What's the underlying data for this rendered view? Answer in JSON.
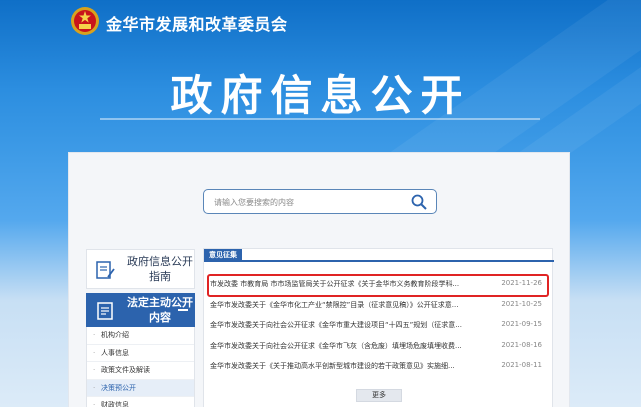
{
  "header": {
    "agency_name": "金华市发展和改革委员会",
    "banner_title": "政府信息公开"
  },
  "search": {
    "placeholder": "请输入您要搜索的内容"
  },
  "sidebar": {
    "guide_label": "政府信息公开指南",
    "section_label": "法定主动公开内容",
    "items": [
      {
        "label": "机构介绍"
      },
      {
        "label": "人事信息"
      },
      {
        "label": "政策文件及解读"
      },
      {
        "label": "决策预公开",
        "active": true
      },
      {
        "label": "财政信息"
      }
    ]
  },
  "content": {
    "tab_label": "意见征集",
    "rows": [
      {
        "title": "市发改委 市教育局 市市场监管局关于公开征求《关于金华市义务教育阶段学科...",
        "date": "2021-11-26",
        "highlighted": true
      },
      {
        "title": "金华市发改委关于《金华市化工产业“禁限控”目录（征求意见稿）》公开征求意...",
        "date": "2021-10-25"
      },
      {
        "title": "金华市发改委关于向社会公开征求《金华市重大建设项目“十四五”规划（征求意...",
        "date": "2021-09-15"
      },
      {
        "title": "金华市发改委关于向社会公开征求《金华市飞灰（含危废）填埋场危废填埋收费...",
        "date": "2021-08-16"
      },
      {
        "title": "金华市发改委关于《关于推动高水平创新型城市建设的若干政策意见》实施细...",
        "date": "2021-08-11"
      }
    ],
    "more_label": "更多"
  },
  "colors": {
    "primary_blue": "#2c63ad",
    "highlight_red": "#e02424"
  }
}
